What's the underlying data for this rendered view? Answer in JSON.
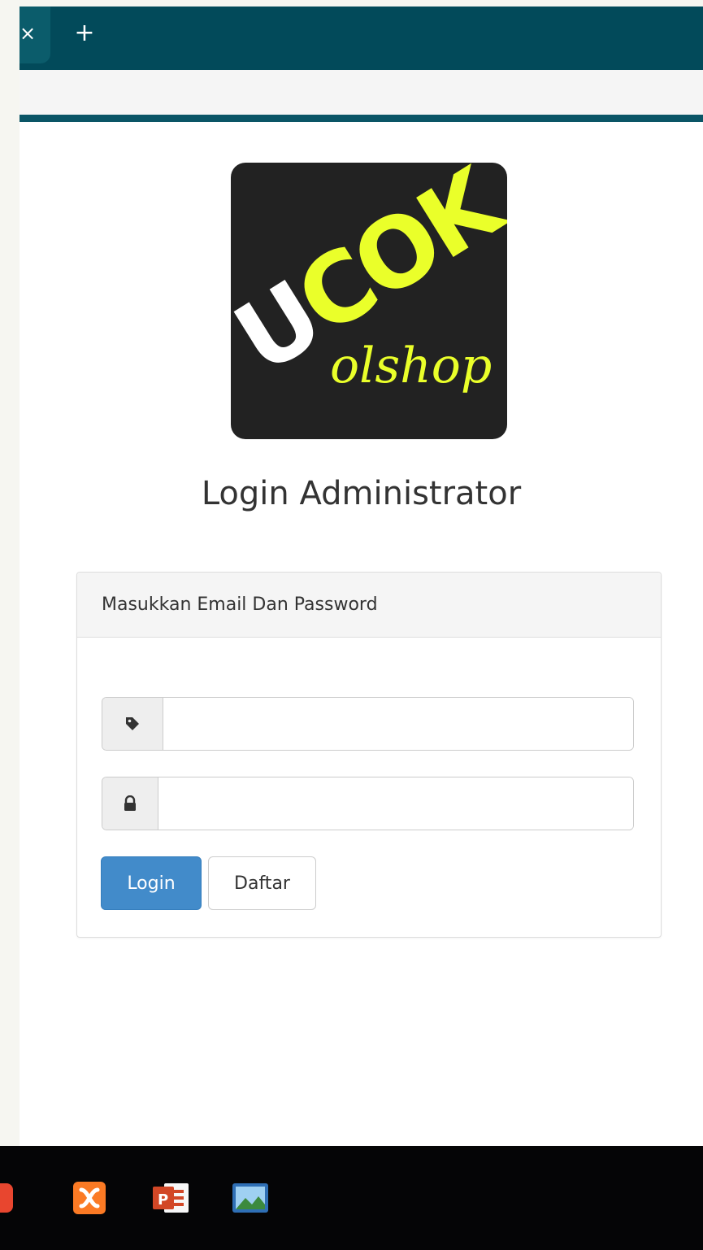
{
  "browser": {
    "tab_close_glyph": "×",
    "new_tab_glyph": "+"
  },
  "logo": {
    "line1": "UCOK",
    "line2": "olshop",
    "bg_color": "#222222",
    "accent_color": "#eaff2a"
  },
  "page": {
    "title": "Login Administrator"
  },
  "login_panel": {
    "heading": "Masukkan Email Dan Password",
    "email_field": {
      "value": "",
      "icon": "tag-icon"
    },
    "password_field": {
      "value": "",
      "icon": "lock-icon"
    },
    "login_button": "Login",
    "register_button": "Daftar"
  },
  "taskbar": {
    "icons": [
      "app-icon",
      "xampp-icon",
      "powerpoint-icon",
      "photos-icon"
    ]
  },
  "colors": {
    "tabstrip": "#024a5a",
    "primary": "#428bca"
  }
}
